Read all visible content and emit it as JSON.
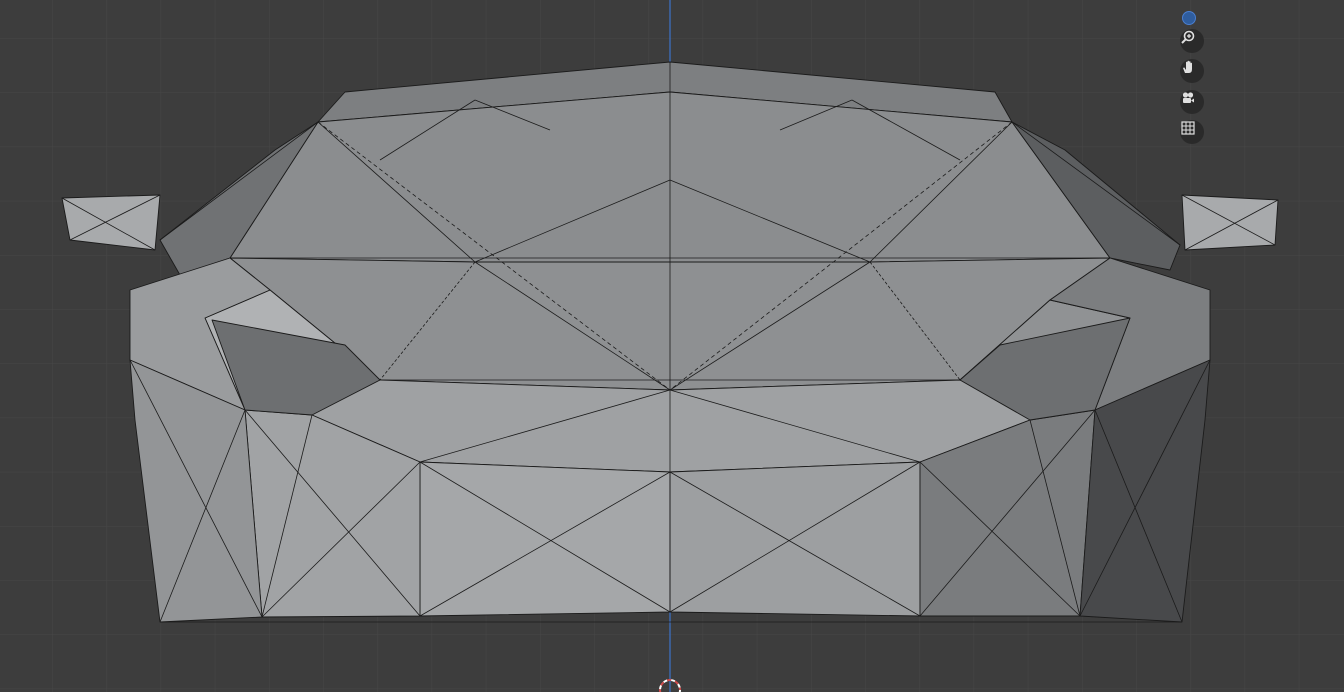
{
  "app": {
    "view": "3D Viewport",
    "colors": {
      "background": "#3d3d3d",
      "grid_line": "#474747",
      "z_axis": "#3c6fbf",
      "mesh_light": "#a3a5a7",
      "mesh_mid": "#8e9092",
      "mesh_dark": "#5e6062",
      "wire": "#1b1b1b",
      "cursor": "#d04b4b"
    }
  },
  "navigation": {
    "axis_gizmo": {
      "axis": "Z",
      "color": "#3c6fbf"
    },
    "buttons": [
      {
        "name": "zoom",
        "icon": "zoom-icon"
      },
      {
        "name": "pan",
        "icon": "hand-icon"
      },
      {
        "name": "camera",
        "icon": "camera-icon"
      },
      {
        "name": "ortho-persp",
        "icon": "grid-icon"
      }
    ]
  }
}
